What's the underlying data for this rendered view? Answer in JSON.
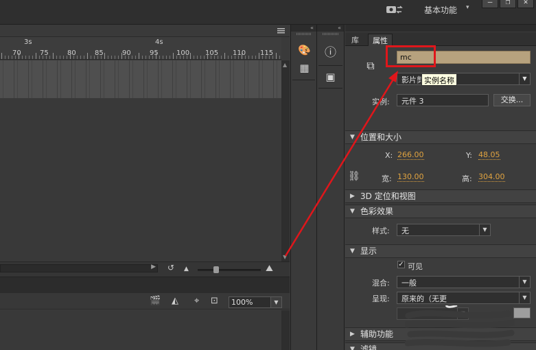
{
  "topbar": {
    "workspace_label": "基本功能",
    "workspace_caret": "▾",
    "window_buttons": [
      "—",
      "❐",
      "✕"
    ]
  },
  "timeline": {
    "second_markers": [
      "3s",
      "4s"
    ],
    "frame_labels": [
      "70",
      "75",
      "80",
      "85",
      "90",
      "95",
      "100",
      "105",
      "110",
      "115"
    ]
  },
  "stage": {
    "zoom": "100%"
  },
  "properties": {
    "tabs": [
      "库",
      "属性"
    ],
    "active_tab": "属性",
    "instance_name": "mc",
    "tooltip": "实例名称",
    "type_value": "影片剪",
    "instance_of_label": "实例:",
    "instance_of_value": "元件 3",
    "swap_button": "交换...",
    "sections": {
      "position_size": "位置和大小",
      "three_d": "3D 定位和视图",
      "color_effect": "色彩效果",
      "display": "显示",
      "accessibility": "辅助功能",
      "filters": "滤镜"
    },
    "x_label": "X:",
    "x_value": "266.00",
    "y_label": "Y:",
    "y_value": "48.05",
    "width_label": "宽:",
    "width_value": "130.00",
    "height_label": "高:",
    "height_value": "304.00",
    "style_label": "样式:",
    "style_value": "无",
    "visible_label": "可见",
    "visible_checked": true,
    "blend_label": "混合:",
    "blend_value": "一般",
    "render_label": "呈现:",
    "render_value": "原来的（无更"
  },
  "colors": {
    "accent_red": "#e0161b",
    "value_orange": "#e0a340",
    "name_field_bg": "#b7a27e",
    "tooltip_bg": "#ffffe1"
  }
}
